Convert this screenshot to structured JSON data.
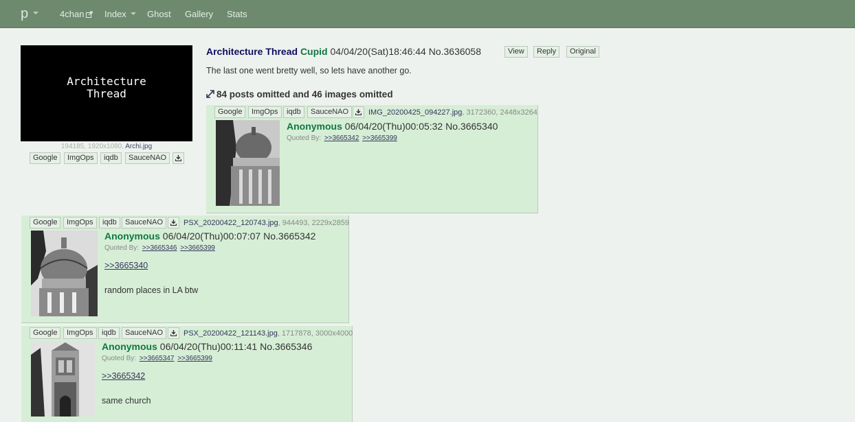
{
  "nav": {
    "brand": "p",
    "items": [
      {
        "label": "4chan"
      },
      {
        "label": "Index"
      },
      {
        "label": "Ghost"
      },
      {
        "label": "Gallery"
      },
      {
        "label": "Stats"
      }
    ]
  },
  "image_search": {
    "google": "Google",
    "imgops": "ImgOps",
    "iqdb": "iqdb",
    "saucenao": "SauceNAO"
  },
  "op": {
    "thumb_text_line1": "Architecture",
    "thumb_text_line2": "Thread",
    "file_meta": "194185, 1920x1080,",
    "file_name": "Archi.jpg",
    "subject": "Architecture Thread",
    "name": "Cupid",
    "datetime": "04/04/20(Sat)18:46:44",
    "number": "No.3636058",
    "view_label": "View",
    "reply_label": "Reply",
    "original_label": "Original",
    "body": "The last one went bretty well, so lets have another go.",
    "omitted": "84 posts omitted and 46 images omitted"
  },
  "replies": [
    {
      "file_name": "IMG_20200425_094227.jpg",
      "file_meta": ", 3172360, 2448x3264",
      "name": "Anonymous",
      "datetime": "06/04/20(Thu)00:05:32",
      "number": "No.3665340",
      "quoted_by_label": "Quoted By:",
      "quoted_by": [
        ">>3665342",
        ">>3665399"
      ],
      "quote": "",
      "text": ""
    },
    {
      "file_name": "PSX_20200422_120743.jpg",
      "file_meta": ", 944493, 2229x2859",
      "name": "Anonymous",
      "datetime": "06/04/20(Thu)00:07:07",
      "number": "No.3665342",
      "quoted_by_label": "Quoted By:",
      "quoted_by": [
        ">>3665346",
        ">>3665399"
      ],
      "quote": ">>3665340",
      "text": "random places in LA btw"
    },
    {
      "file_name": "PSX_20200422_121143.jpg",
      "file_meta": ", 1717878, 3000x4000",
      "name": "Anonymous",
      "datetime": "06/04/20(Thu)00:11:41",
      "number": "No.3665346",
      "quoted_by_label": "Quoted By:",
      "quoted_by": [
        ">>3665347",
        ">>3665399"
      ],
      "quote": ">>3665342",
      "text": "same church"
    }
  ],
  "colors": {
    "navbar": "#6d8a6e",
    "background": "#eef2ee",
    "reply_bg": "#d6eed6",
    "name": "#117743",
    "subject": "#0f0c5d",
    "link": "#34345c"
  },
  "icons": {
    "external": "external-link-icon",
    "download": "download-icon",
    "expand": "expand-icon"
  }
}
